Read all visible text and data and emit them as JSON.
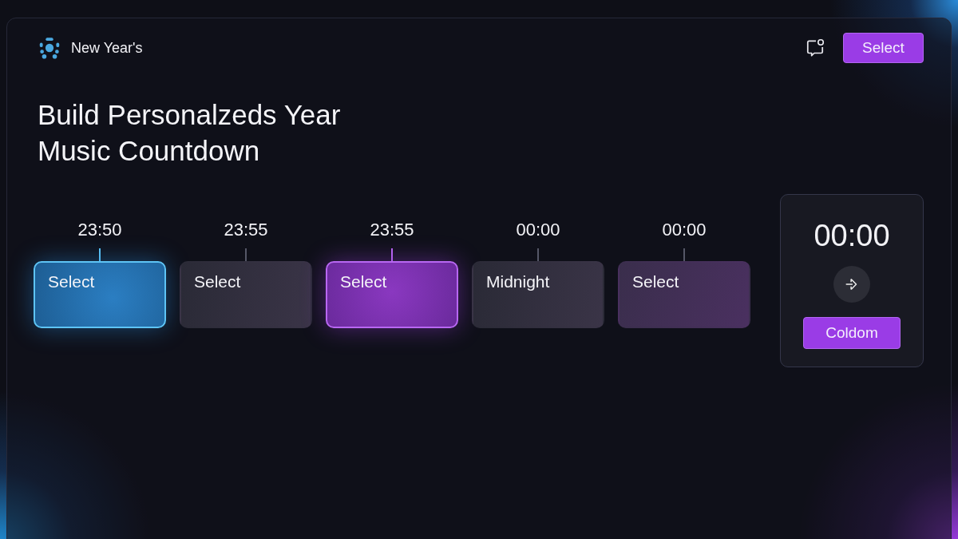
{
  "app": {
    "name": "New Year's"
  },
  "header": {
    "notification_dot": true,
    "button": "Select"
  },
  "title": "Build Personalzeds Year\nMusic Countdown",
  "timeline": [
    {
      "time": "23:50",
      "label": "Select",
      "kind": "cyan"
    },
    {
      "time": "23:55",
      "label": "Select",
      "kind": "plain"
    },
    {
      "time": "23:55",
      "label": "Select",
      "kind": "violet"
    },
    {
      "time": "00:00",
      "label": "Midnight",
      "kind": "plain"
    },
    {
      "time": "00:00",
      "label": "Select",
      "kind": "muted"
    }
  ],
  "countdown": {
    "time": "00:00",
    "button": "Coldom"
  }
}
